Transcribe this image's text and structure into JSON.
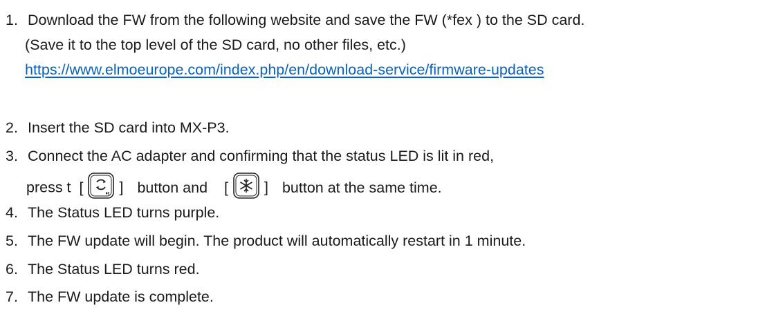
{
  "steps": [
    {
      "number": "1.",
      "text": "Download the FW from the following website and save the FW (*fex ) to the SD card.",
      "note": "(Save it to the top level of the SD card, no other files, etc.)",
      "link": "https://www.elmoeurope.com/index.php/en/download-service/firmware-updates"
    },
    {
      "number": "2.",
      "text": "Insert the SD card into MX-P3."
    },
    {
      "number": "3.",
      "text": "Connect the AC adapter and confirming that the status LED is lit in red,",
      "press_prefix": "press t",
      "button1_icon": "rotate-play-icon",
      "between": "button and",
      "button2_icon": "snowflake-icon",
      "suffix": "button at the same time.",
      "bracket_open": "[",
      "bracket_close": "]"
    },
    {
      "number": "4.",
      "text": "The Status LED turns purple."
    },
    {
      "number": "5.",
      "text": "The FW update will begin. The product will automatically restart in 1 minute."
    },
    {
      "number": "6.",
      "text": "The Status LED turns red."
    },
    {
      "number": "7.",
      "text": "The FW update is complete."
    }
  ]
}
